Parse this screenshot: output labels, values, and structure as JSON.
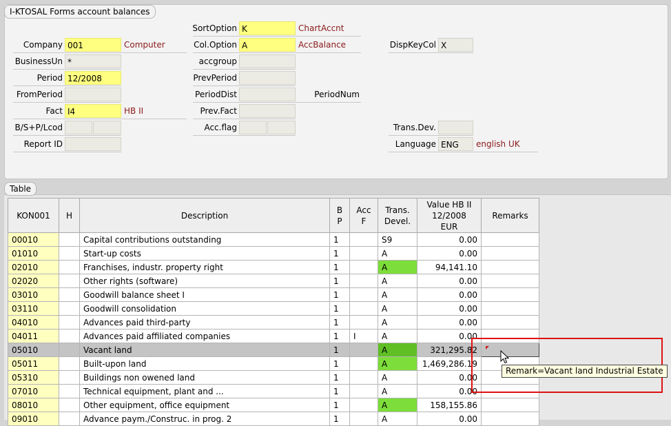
{
  "form": {
    "title": "I-KTOSAL Forms account balances",
    "col1": [
      {
        "label": "Company",
        "value": "001",
        "desc": "Computer",
        "yellow": true
      },
      {
        "label": "BusinessUn",
        "value": "*",
        "desc": "",
        "yellow": false
      },
      {
        "label": "Period",
        "value": "12/2008",
        "desc": "",
        "yellow": true
      },
      {
        "label": "FromPeriod",
        "value": "",
        "desc": "",
        "yellow": false
      },
      {
        "label": "Fact",
        "value": "I4",
        "desc": "HB II",
        "yellow": true
      },
      {
        "label": "B/S+P/Lcod",
        "value": "",
        "value2": "",
        "desc": ""
      },
      {
        "label": "Report ID",
        "value": "",
        "desc": ""
      }
    ],
    "col2": [
      {
        "label": "SortOption",
        "value": "K",
        "desc": "ChartAccnt",
        "yellow": true
      },
      {
        "label": "Col.Option",
        "value": "A",
        "desc": "AccBalance",
        "yellow": true
      },
      {
        "label": "accgroup",
        "value": "",
        "desc": ""
      },
      {
        "label": "PrevPeriod",
        "value": "",
        "desc": ""
      },
      {
        "label": "PeriodDist",
        "value": "",
        "desc": "PeriodNum"
      },
      {
        "label": "Prev.Fact",
        "value": "",
        "desc": ""
      },
      {
        "label": "Acc.flag",
        "value": "",
        "value2": "",
        "desc": ""
      }
    ],
    "col3": [
      {
        "label": "DispKeyCol",
        "value": "X",
        "desc": ""
      },
      {
        "label": "Trans.Dev.",
        "value": "",
        "desc": ""
      },
      {
        "label": "Language",
        "value": "ENG",
        "desc": "english UK"
      }
    ]
  },
  "table": {
    "title": "Table",
    "headers": {
      "kon": "KON001",
      "h": "H",
      "desc": "Description",
      "bp1": "B",
      "bp2": "P",
      "acc1": "Acc",
      "acc2": "F",
      "trans1": "Trans.",
      "trans2": "Devel.",
      "val1": "Value HB II",
      "val2": "12/2008",
      "val3": "EUR",
      "rem": "Remarks"
    },
    "rows": [
      {
        "kon": "00010",
        "h": "",
        "desc": "Capital contributions outstanding",
        "bp": "1",
        "acc": "",
        "trans": "S9",
        "green": false,
        "value": "0.00",
        "remark": ""
      },
      {
        "kon": "01010",
        "h": "",
        "desc": "Start-up costs",
        "bp": "1",
        "acc": "",
        "trans": "A",
        "green": false,
        "value": "0.00",
        "remark": ""
      },
      {
        "kon": "02010",
        "h": "",
        "desc": "Franchises, industr. property right",
        "bp": "1",
        "acc": "",
        "trans": "A",
        "green": true,
        "value": "94,141.10",
        "remark": ""
      },
      {
        "kon": "02020",
        "h": "",
        "desc": "Other rights (software)",
        "bp": "1",
        "acc": "",
        "trans": "A",
        "green": false,
        "value": "0.00",
        "remark": ""
      },
      {
        "kon": "03010",
        "h": "",
        "desc": "Goodwill balance sheet I",
        "bp": "1",
        "acc": "",
        "trans": "A",
        "green": false,
        "value": "0.00",
        "remark": ""
      },
      {
        "kon": "03110",
        "h": "",
        "desc": "Goodwill consolidation",
        "bp": "1",
        "acc": "",
        "trans": "A",
        "green": false,
        "value": "0.00",
        "remark": ""
      },
      {
        "kon": "04010",
        "h": "",
        "desc": "Advances paid third-party",
        "bp": "1",
        "acc": "",
        "trans": "A",
        "green": false,
        "value": "0.00",
        "remark": ""
      },
      {
        "kon": "04011",
        "h": "",
        "desc": "Advances paid affiliated companies",
        "bp": "1",
        "acc": "I",
        "trans": "A",
        "green": false,
        "value": "0.00",
        "remark": ""
      },
      {
        "kon": "05010",
        "h": "",
        "desc": "Vacant land",
        "bp": "1",
        "acc": "",
        "trans": "A",
        "green": true,
        "value": "321,295.82",
        "remark": "",
        "selected": true,
        "flag": true
      },
      {
        "kon": "05011",
        "h": "",
        "desc": "Built-upon land",
        "bp": "1",
        "acc": "",
        "trans": "A",
        "green": true,
        "value": "1,469,286.19",
        "remark": ""
      },
      {
        "kon": "05310",
        "h": "",
        "desc": "Buildings non owened land",
        "bp": "1",
        "acc": "",
        "trans": "A",
        "green": false,
        "value": "0.00",
        "remark": ""
      },
      {
        "kon": "07010",
        "h": "",
        "desc": "Technical equipment, plant and ...",
        "bp": "1",
        "acc": "",
        "trans": "A",
        "green": false,
        "value": "0.00",
        "remark": ""
      },
      {
        "kon": "08010",
        "h": "",
        "desc": "Other equipment, office equipment",
        "bp": "1",
        "acc": "",
        "trans": "A",
        "green": true,
        "value": "158,155.86",
        "remark": ""
      },
      {
        "kon": "09010",
        "h": "",
        "desc": "Advance paym./Construc. in prog. 2",
        "bp": "1",
        "acc": "",
        "trans": "A",
        "green": false,
        "value": "0.00",
        "remark": ""
      }
    ]
  },
  "tooltip": "Remark=Vacant land Industrial Estate",
  "colors": {
    "field_yellow": "#ffff80",
    "key_yellow": "#ffffc0",
    "trans_green": "#7ddd3a",
    "desc_red": "#8b1a1a",
    "highlight": "#e01010"
  }
}
